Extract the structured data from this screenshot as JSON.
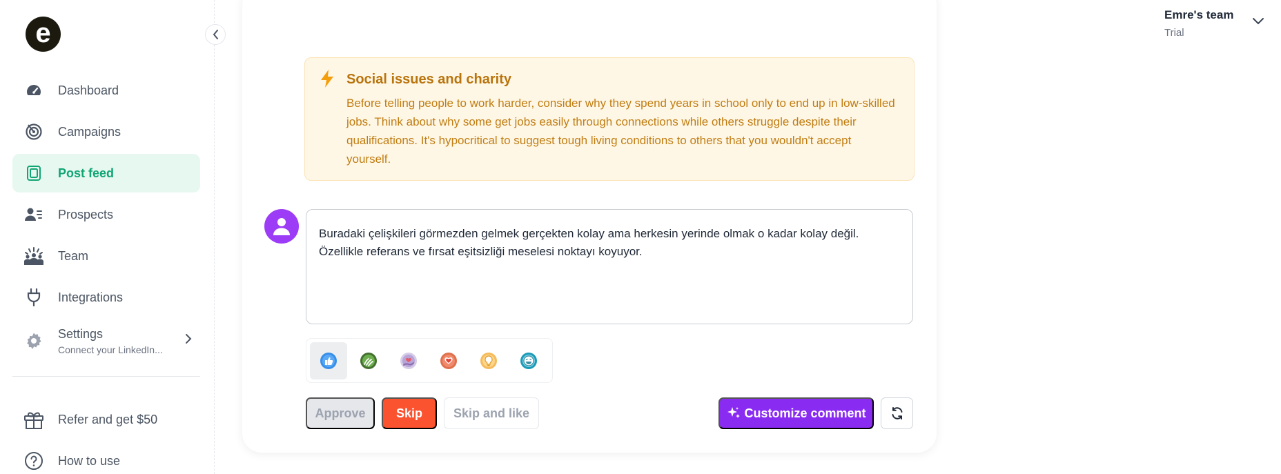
{
  "sidebar": {
    "logo_letter": "e",
    "items": [
      {
        "label": "Dashboard",
        "icon": "gauge-icon"
      },
      {
        "label": "Campaigns",
        "icon": "target-icon"
      },
      {
        "label": "Post feed",
        "icon": "feed-icon",
        "active": true
      },
      {
        "label": "Prospects",
        "icon": "prospects-icon"
      },
      {
        "label": "Team",
        "icon": "team-icon"
      },
      {
        "label": "Integrations",
        "icon": "plug-icon"
      }
    ],
    "settings": {
      "label": "Settings",
      "sublabel": "Connect your LinkedIn..."
    },
    "footer": [
      {
        "label": "Refer and get $50",
        "icon": "gift-icon"
      },
      {
        "label": "How to use",
        "icon": "help-icon"
      }
    ]
  },
  "team": {
    "name": "Emre's team",
    "plan": "Trial"
  },
  "alert": {
    "title": "Social issues and charity",
    "body": "Before telling people to work harder, consider why they spend years in school only to end up in low-skilled jobs. Think about why some get jobs easily through connections while others struggle despite their qualifications. It's hypocritical to suggest tough living conditions to others that you wouldn't accept yourself."
  },
  "comment": {
    "text": "Buradaki çelişkileri görmezden gelmek gerçekten kolay ama herkesin yerinde olmak o kadar kolay değil. Özellikle referans ve fırsat eşitsizliği meselesi noktayı koyuyor."
  },
  "reactions": [
    "like",
    "celebrate",
    "support",
    "love",
    "insightful",
    "funny"
  ],
  "actions": {
    "approve": "Approve",
    "skip": "Skip",
    "skip_and_like": "Skip and like",
    "customize": "Customize comment"
  },
  "colors": {
    "accent": "#12a574",
    "purple": "#8a2bf2",
    "skip": "#fb5230",
    "alert_text": "#c07d12"
  }
}
